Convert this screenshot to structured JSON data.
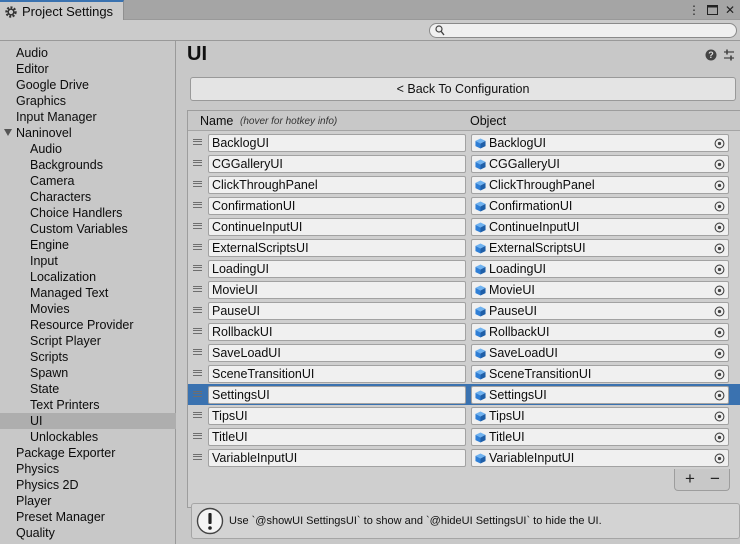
{
  "window": {
    "tab_title": "Project Settings",
    "search_placeholder": ""
  },
  "sidebar": {
    "items": [
      {
        "label": "Audio",
        "level": 0
      },
      {
        "label": "Editor",
        "level": 0
      },
      {
        "label": "Google Drive",
        "level": 0
      },
      {
        "label": "Graphics",
        "level": 0
      },
      {
        "label": "Input Manager",
        "level": 0
      },
      {
        "label": "Naninovel",
        "level": 0,
        "expanded": true
      },
      {
        "label": "Audio",
        "level": 1
      },
      {
        "label": "Backgrounds",
        "level": 1
      },
      {
        "label": "Camera",
        "level": 1
      },
      {
        "label": "Characters",
        "level": 1
      },
      {
        "label": "Choice Handlers",
        "level": 1
      },
      {
        "label": "Custom Variables",
        "level": 1
      },
      {
        "label": "Engine",
        "level": 1
      },
      {
        "label": "Input",
        "level": 1
      },
      {
        "label": "Localization",
        "level": 1
      },
      {
        "label": "Managed Text",
        "level": 1
      },
      {
        "label": "Movies",
        "level": 1
      },
      {
        "label": "Resource Provider",
        "level": 1
      },
      {
        "label": "Script Player",
        "level": 1
      },
      {
        "label": "Scripts",
        "level": 1
      },
      {
        "label": "Spawn",
        "level": 1
      },
      {
        "label": "State",
        "level": 1
      },
      {
        "label": "Text Printers",
        "level": 1
      },
      {
        "label": "UI",
        "level": 1,
        "selected": true
      },
      {
        "label": "Unlockables",
        "level": 1
      },
      {
        "label": "Package Exporter",
        "level": 0
      },
      {
        "label": "Physics",
        "level": 0
      },
      {
        "label": "Physics 2D",
        "level": 0
      },
      {
        "label": "Player",
        "level": 0
      },
      {
        "label": "Preset Manager",
        "level": 0
      },
      {
        "label": "Quality",
        "level": 0
      }
    ]
  },
  "main": {
    "title": "UI",
    "back_button_label": "< Back To Configuration",
    "list": {
      "header_name": "Name",
      "header_hint": "(hover for hotkey info)",
      "header_object": "Object",
      "selected_index": 12,
      "rows": [
        {
          "name": "BacklogUI",
          "object": "BacklogUI"
        },
        {
          "name": "CGGalleryUI",
          "object": "CGGalleryUI"
        },
        {
          "name": "ClickThroughPanel",
          "object": "ClickThroughPanel"
        },
        {
          "name": "ConfirmationUI",
          "object": "ConfirmationUI"
        },
        {
          "name": "ContinueInputUI",
          "object": "ContinueInputUI"
        },
        {
          "name": "ExternalScriptsUI",
          "object": "ExternalScriptsUI"
        },
        {
          "name": "LoadingUI",
          "object": "LoadingUI"
        },
        {
          "name": "MovieUI",
          "object": "MovieUI"
        },
        {
          "name": "PauseUI",
          "object": "PauseUI"
        },
        {
          "name": "RollbackUI",
          "object": "RollbackUI"
        },
        {
          "name": "SaveLoadUI",
          "object": "SaveLoadUI"
        },
        {
          "name": "SceneTransitionUI",
          "object": "SceneTransitionUI"
        },
        {
          "name": "SettingsUI",
          "object": "SettingsUI"
        },
        {
          "name": "TipsUI",
          "object": "TipsUI"
        },
        {
          "name": "TitleUI",
          "object": "TitleUI"
        },
        {
          "name": "VariableInputUI",
          "object": "VariableInputUI"
        }
      ]
    },
    "add_label": "+",
    "remove_label": "−",
    "help_text": "Use `@showUI SettingsUI` to show and `@hideUI SettingsUI` to hide the UI."
  },
  "colors": {
    "selection": "#3a72b0",
    "prefab_icon": "#2f7fd6",
    "background": "#c8c8c8"
  },
  "icons": [
    "gear-icon",
    "more-icon",
    "maximize-icon",
    "close-icon",
    "search-icon",
    "help-icon",
    "preset-icon",
    "drag-handle-icon",
    "prefab-cube-icon",
    "object-picker-icon",
    "warning-icon"
  ]
}
